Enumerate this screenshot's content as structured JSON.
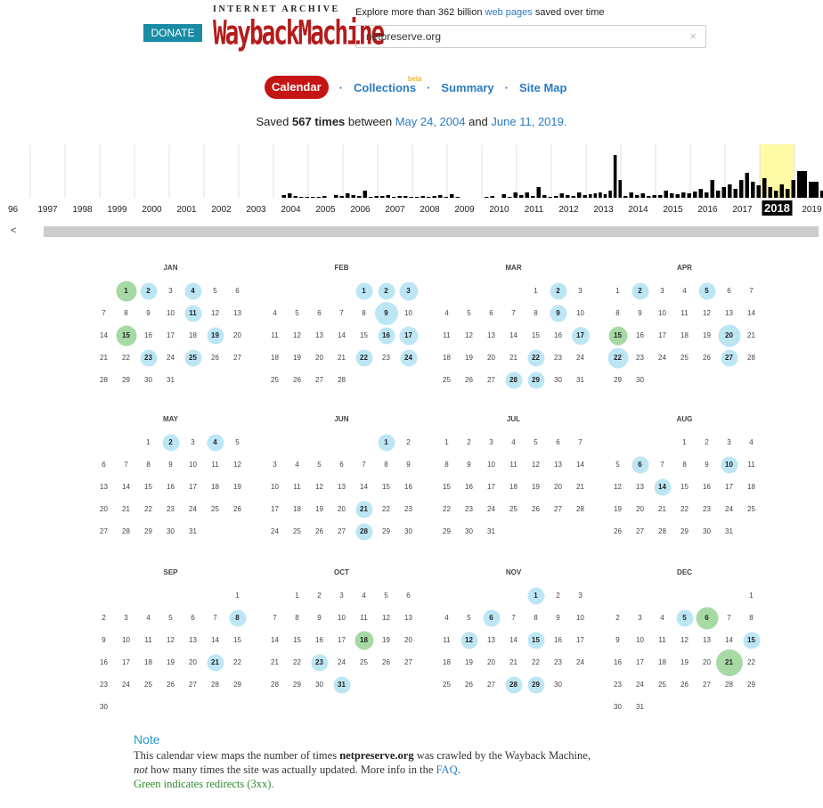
{
  "header": {
    "donate_label": "DONATE",
    "logo_top": "INTERNET ARCHIVE",
    "logo_main": "WaybackMachine",
    "tagline_prefix": "Explore more than 362 billion",
    "tagline_link": "web pages",
    "tagline_suffix": "saved over time",
    "url_value": "netpreserve.org",
    "clear_glyph": "×"
  },
  "nav": {
    "tabs": [
      {
        "label": "Calendar",
        "active": true
      },
      {
        "label": "Collections",
        "badge": "beta"
      },
      {
        "label": "Summary"
      },
      {
        "label": "Site Map"
      }
    ],
    "separator": "·"
  },
  "saved": {
    "prefix": "Saved",
    "count": "567 times",
    "between": "between",
    "start": "May 24, 2004",
    "and": "and",
    "end": "June 11, 2019."
  },
  "sparkline": {
    "years": [
      "96",
      "1997",
      "1998",
      "1999",
      "2000",
      "2001",
      "2002",
      "2003",
      "2004",
      "2005",
      "2006",
      "2007",
      "2008",
      "2009",
      "2010",
      "2011",
      "2012",
      "2013",
      "2014",
      "2015",
      "2016",
      "2017",
      "2018",
      "2019"
    ],
    "selected_year": "2018",
    "highlight_color": "#fffaa6",
    "scroll_left_glyph": "<"
  },
  "calendar": {
    "year": 2018,
    "months": [
      {
        "name": "JAN",
        "offset": 1,
        "days": 31,
        "cap": {
          "1": "g",
          "2": "b",
          "4": "b",
          "11": "b",
          "15": "g",
          "19": "b",
          "23": "b",
          "25": "b"
        }
      },
      {
        "name": "FEB",
        "offset": 4,
        "days": 28,
        "cap": {
          "1": "b",
          "2": "b",
          "3": "b",
          "9": "b",
          "16": "b",
          "17": "b",
          "22": "b",
          "24": "b"
        }
      },
      {
        "name": "MAR",
        "offset": 4,
        "days": 31,
        "cap": {
          "2": "b",
          "9": "b",
          "17": "b",
          "22": "b",
          "28": "b",
          "29": "b"
        }
      },
      {
        "name": "APR",
        "offset": 0,
        "days": 30,
        "cap": {
          "2": "b",
          "5": "b",
          "15": "g",
          "20": "b",
          "22": "b",
          "27": "b"
        }
      },
      {
        "name": "MAY",
        "offset": 2,
        "days": 31,
        "cap": {
          "2": "b",
          "4": "b"
        }
      },
      {
        "name": "JUN",
        "offset": 5,
        "days": 30,
        "cap": {
          "1": "b",
          "21": "b",
          "28": "b"
        }
      },
      {
        "name": "JUL",
        "offset": 0,
        "days": 31,
        "cap": {}
      },
      {
        "name": "AUG",
        "offset": 3,
        "days": 31,
        "cap": {
          "6": "b",
          "10": "b",
          "14": "b"
        }
      },
      {
        "name": "SEP",
        "offset": 6,
        "days": 30,
        "cap": {
          "8": "b",
          "21": "b"
        }
      },
      {
        "name": "OCT",
        "offset": 1,
        "days": 31,
        "cap": {
          "18": "g",
          "23": "b",
          "31": "b"
        }
      },
      {
        "name": "NOV",
        "offset": 4,
        "days": 30,
        "cap": {
          "1": "b",
          "6": "b",
          "12": "b",
          "15": "b",
          "28": "b",
          "29": "b"
        }
      },
      {
        "name": "DEC",
        "offset": 6,
        "days": 31,
        "cap": {
          "5": "b",
          "6": "g",
          "15": "b",
          "21": "g"
        }
      }
    ],
    "colors": {
      "blue": "#bde6f5",
      "green": "#a7d9a5"
    }
  },
  "note": {
    "title": "Note",
    "line1_prefix": "This calendar view maps the number of times",
    "line1_site": "netpreserve.org",
    "line1_suffix": "was crawled by the Wayback Machine,",
    "line2_italic": "not",
    "line2_middle": "how many times the site was actually updated. More info in the",
    "line2_link": "FAQ",
    "line2_end": ".",
    "line3": "Green indicates redirects (3xx)."
  }
}
